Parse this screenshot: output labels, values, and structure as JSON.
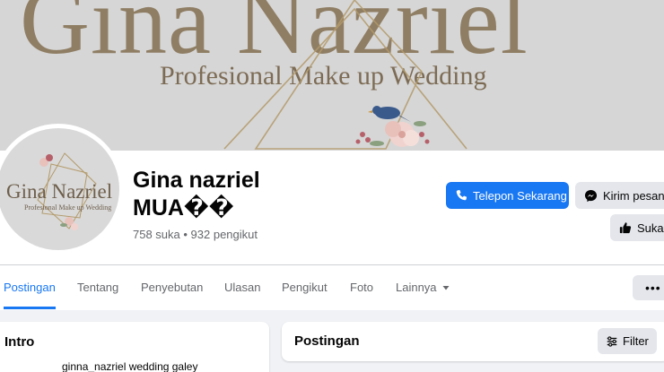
{
  "cover": {
    "title": "Gina Nazriel",
    "subtitle": "Profesional Make up Wedding"
  },
  "avatar": {
    "name": "Gina Nazriel",
    "subtitle": "Profesional Make up Wedding"
  },
  "profile": {
    "name_line1": "Gina nazriel",
    "name_line2": "MUA��",
    "stats": "758 suka • 932 pengikut"
  },
  "actions": {
    "call_label": "Telepon Sekarang",
    "message_label": "Kirim pesan",
    "like_label": "Suka"
  },
  "tabs": [
    {
      "label": "Postingan",
      "active": true
    },
    {
      "label": "Tentang"
    },
    {
      "label": "Penyebutan"
    },
    {
      "label": "Ulasan"
    },
    {
      "label": "Pengikut"
    },
    {
      "label": "Foto"
    },
    {
      "label": "Lainnya"
    }
  ],
  "more_menu": "•••",
  "intro": {
    "title": "Intro",
    "text": "ginna_nazriel wedding galey"
  },
  "posts": {
    "title": "Postingan",
    "filter_label": "Filter"
  },
  "colors": {
    "accent": "#1877f2",
    "cover_bg": "#d6d6d6",
    "cover_text": "#8f7e64",
    "page_bg": "#f0f2f5"
  },
  "icons": [
    "phone-icon",
    "messenger-icon",
    "thumbs-up-icon",
    "chevron-down-icon",
    "more-dots-icon",
    "filter-sliders-icon"
  ]
}
